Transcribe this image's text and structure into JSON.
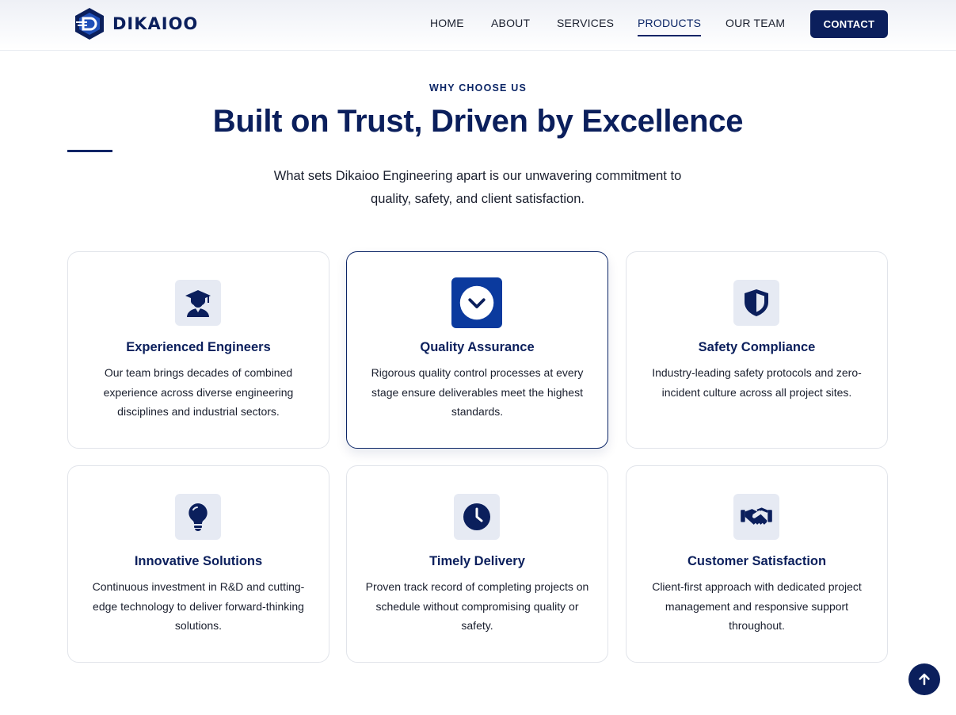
{
  "brand": {
    "name": "DIKAIOO"
  },
  "nav": {
    "items": [
      {
        "label": "HOME"
      },
      {
        "label": "ABOUT"
      },
      {
        "label": "SERVICES"
      },
      {
        "label": "PRODUCTS",
        "active": true
      },
      {
        "label": "OUR TEAM"
      }
    ],
    "contact_label": "CONTACT"
  },
  "section": {
    "eyebrow": "WHY CHOOSE US",
    "title": "Built on Trust, Driven by Excellence",
    "intro": "What sets Dikaioo Engineering apart is our unwavering commitment to quality, safety, and client satisfaction."
  },
  "cards": [
    {
      "icon": "graduate-icon",
      "title": "Experienced Engineers",
      "desc": "Our team brings decades of combined experience across diverse engineering disciplines and industrial sectors."
    },
    {
      "icon": "chevron-circle-icon",
      "title": "Quality Assurance",
      "desc": "Rigorous quality control processes at every stage ensure deliverables meet the highest standards."
    },
    {
      "icon": "shield-icon",
      "title": "Safety Compliance",
      "desc": "Industry-leading safety protocols and zero-incident culture across all project sites."
    },
    {
      "icon": "lightbulb-icon",
      "title": "Innovative Solutions",
      "desc": "Continuous investment in R&D and cutting-edge technology to deliver forward-thinking solutions."
    },
    {
      "icon": "clock-icon",
      "title": "Timely Delivery",
      "desc": "Proven track record of completing projects on schedule without compromising quality or safety."
    },
    {
      "icon": "handshake-icon",
      "title": "Customer Satisfaction",
      "desc": "Client-first approach with dedicated project management and responsive support throughout."
    }
  ],
  "colors": {
    "navy": "#0b1f5c",
    "accent_blue": "#0b3a9e",
    "icon_bg": "#e6eaf3"
  }
}
